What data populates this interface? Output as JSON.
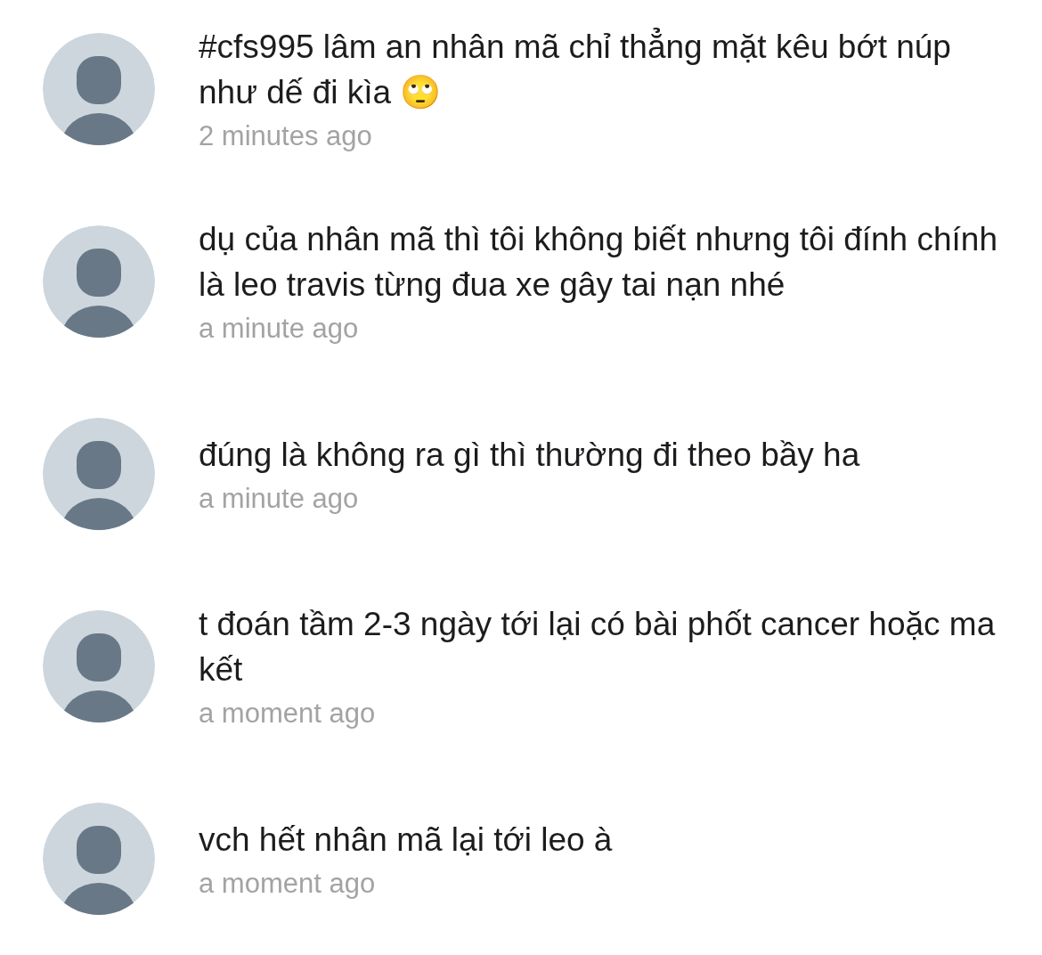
{
  "comments": [
    {
      "text": "#cfs995 lâm an nhân mã chỉ thẳng mặt kêu bớt núp như dế đi kìa 🙄",
      "time": "2 minutes ago"
    },
    {
      "text": "dụ của nhân mã thì tôi không biết nhưng tôi đính chính là leo travis từng đua xe gây tai nạn nhé",
      "time": "a minute ago"
    },
    {
      "text": "đúng là không ra gì thì thường đi theo bầy ha",
      "time": "a minute ago"
    },
    {
      "text": "t đoán tầm 2-3 ngày tới lại có bài phốt cancer hoặc ma kết",
      "time": "a moment ago"
    },
    {
      "text": "vch hết nhân mã lại tới leo à",
      "time": "a moment ago"
    }
  ]
}
